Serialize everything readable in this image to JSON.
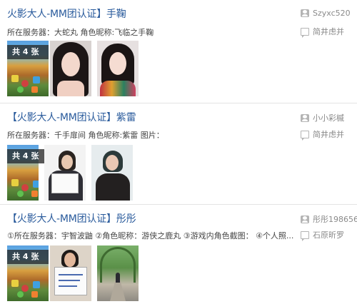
{
  "posts": [
    {
      "title": "火影大人-MM团认证】手鞠",
      "meta": "所在服务器：大蛇丸 角色昵称:飞临之手鞠",
      "author": "Szyxc520",
      "replier": "简井虑并",
      "image_count_label": "共 4 张"
    },
    {
      "title": "【火影大人-MM团认证】紫雷",
      "meta": "所在服务器：千手扉间 角色昵称:紫雷 图片：",
      "author": "小小彩槭",
      "replier": "简井虑并",
      "image_count_label": "共 4 张"
    },
    {
      "title": "【火影大人-MM团认证】彤彤",
      "meta": "①所在服务器：宇智波鼬 ②角色昵称：游侠之鹿丸 ③游戏内角色截图： ④个人照...",
      "author": "彤彤198656",
      "replier": "石原昕罗",
      "image_count_label": "共 4 张"
    }
  ],
  "icons": {
    "author": "user-icon",
    "replier": "reply-icon"
  }
}
